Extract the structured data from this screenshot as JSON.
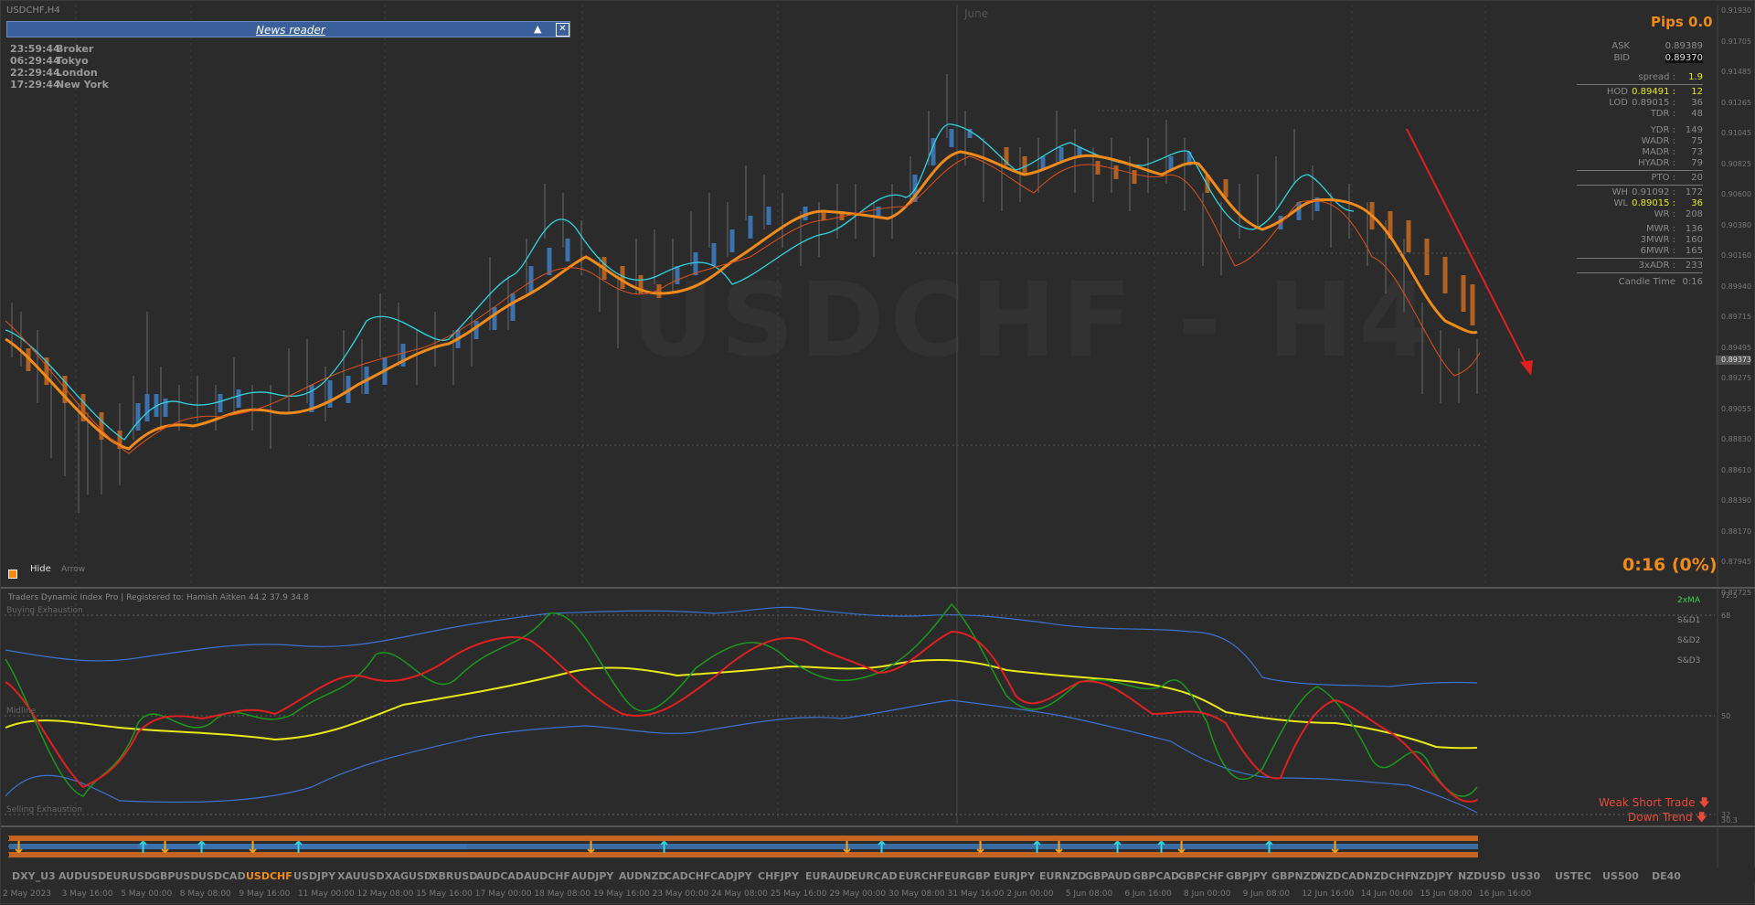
{
  "window": {
    "title": "USDCHF,H4",
    "month_label": "June",
    "watermark": "USDCHF - H4"
  },
  "news_reader": {
    "title": "News reader",
    "collapse_icon": "triangle-up",
    "close_icon": "close-box"
  },
  "sessions": [
    {
      "time": "23:59:44",
      "name": "Broker"
    },
    {
      "time": "06:29:44",
      "name": "Tokyo"
    },
    {
      "time": "22:29:44",
      "name": "London"
    },
    {
      "time": "17:29:44",
      "name": "New York"
    }
  ],
  "price_axis": [
    "0.91930",
    "0.91705",
    "0.91485",
    "0.91265",
    "0.91045",
    "0.90825",
    "0.90600",
    "0.90380",
    "0.90160",
    "0.89940",
    "0.89715",
    "0.89495",
    "0.89275",
    "0.89055",
    "0.88830",
    "0.88610",
    "0.88390",
    "0.88170",
    "0.87945",
    "0.87725"
  ],
  "current_price": "0.89373",
  "info_panel": {
    "pips": "Pips 0.0",
    "ask_label": "ASK",
    "ask": "0.89389",
    "bid_label": "BID",
    "bid": "0.89370",
    "spread_label": "spread :",
    "spread": "1.9",
    "hod_label": "HOD",
    "hod": "0.89491 :",
    "hod_val": "12",
    "lod_label": "LOD",
    "lod": "0.89015 :",
    "lod_val": "36",
    "rows": [
      {
        "label": "TDR :",
        "value": "48"
      },
      {
        "label": "YDR :",
        "value": "149"
      },
      {
        "label": "WADR :",
        "value": "75"
      },
      {
        "label": "MADR :",
        "value": "73"
      },
      {
        "label": "HYADR :",
        "value": "79"
      },
      {
        "label": "PTO :",
        "value": "20"
      }
    ],
    "wh_label": "WH",
    "wh": "0.91092 :",
    "wh_val": "172",
    "wl_label": "WL",
    "wl": "0.89015 :",
    "wl_val": "36",
    "rows2": [
      {
        "label": "WR :",
        "value": "208"
      },
      {
        "label": "MWR :",
        "value": "136"
      },
      {
        "label": "3MWR :",
        "value": "160"
      },
      {
        "label": "6MWR :",
        "value": "165"
      },
      {
        "label": "3xADR :",
        "value": "233"
      }
    ],
    "candle_time_label": "Candle Time",
    "candle_time": "0:16",
    "colors": {
      "accent": "#f08a1a",
      "green": "#7ee32a",
      "yellow": "#e8e81a"
    }
  },
  "candle_timer": "0:16 (0%)",
  "controls": {
    "hide": "Hide",
    "arrow": "Arrow"
  },
  "tdi": {
    "header": "Traders Dynamic Index Pro | Registered to: Hamish Aitken 44.2 37.9 34.8",
    "buying": "Buying Exhaustion",
    "selling": "Selling Exhaustion",
    "midline": "Midline",
    "legend": [
      "2xMA",
      "S&D1",
      "S&D2",
      "S&D3"
    ],
    "levels": [
      "72.5",
      "68",
      "50",
      "32",
      "30.3"
    ],
    "weak_short": "Weak Short Trade",
    "down_trend": "Down Trend"
  },
  "symbols": [
    "DXY_U3",
    "AUDUSD",
    "EURUSD",
    "GBPUSD",
    "USDCAD",
    "USDCHF",
    "USDJPY",
    "XAUUSD",
    "XAGUSD",
    "XBRUSD",
    "AUDCAD",
    "AUDCHF",
    "AUDJPY",
    "AUDNZD",
    "CADCHF",
    "CADJPY",
    "CHFJPY",
    "EURAUD",
    "EURCAD",
    "EURCHF",
    "EURGBP",
    "EURJPY",
    "EURNZD",
    "GBPAUD",
    "GBPCAD",
    "GBPCHF",
    "GBPJPY",
    "GBPNZD",
    "NZDCAD",
    "NZDCHF",
    "NZDJPY",
    "NZDUSD",
    "US30",
    "USTEC",
    "US500",
    "DE40"
  ],
  "active_symbol": "USDCHF",
  "dates": [
    "2 May 2023",
    "3 May 16:00",
    "5 May 00:00",
    "8 May 08:00",
    "9 May 16:00",
    "11 May 00:00",
    "12 May 08:00",
    "15 May 16:00",
    "17 May 00:00",
    "18 May 08:00",
    "19 May 16:00",
    "23 May 00:00",
    "24 May 08:00",
    "25 May 16:00",
    "29 May 00:00",
    "30 May 08:00",
    "31 May 16:00",
    "2 Jun 00:00",
    "5 Jun 08:00",
    "6 Jun 16:00",
    "8 Jun 00:00",
    "9 Jun 08:00",
    "12 Jun 16:00",
    "14 Jun 00:00",
    "15 Jun 08:00",
    "16 Jun 16:00"
  ]
}
